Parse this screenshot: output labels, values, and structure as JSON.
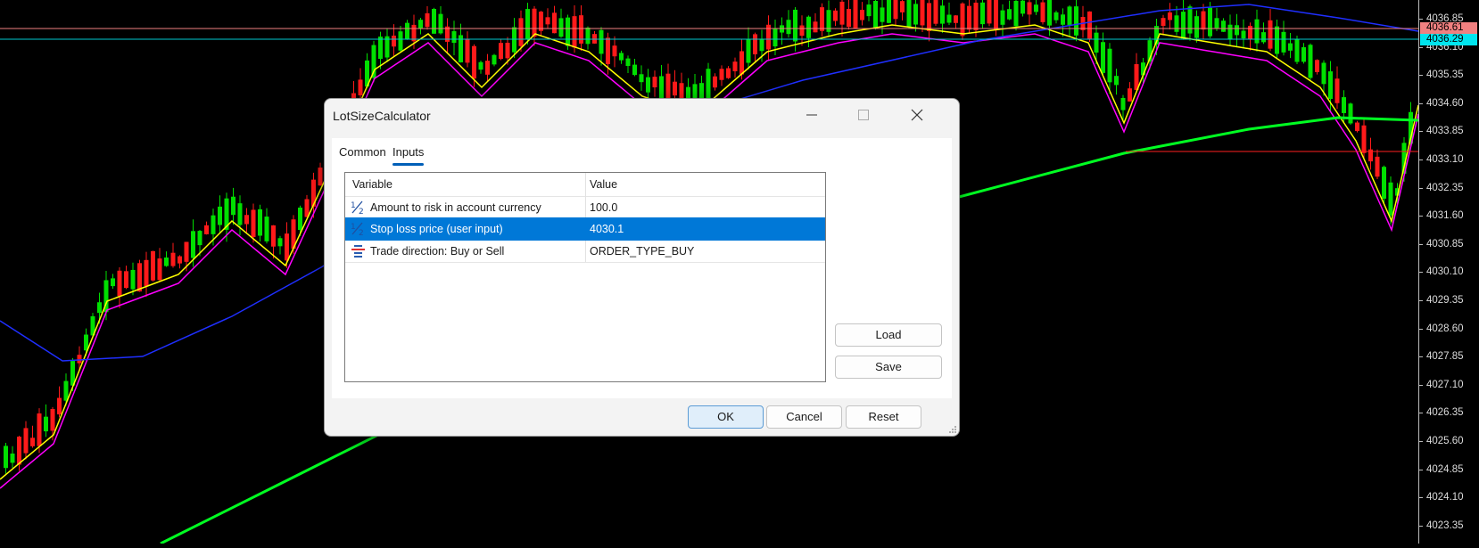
{
  "dialog": {
    "title": "LotSizeCalculator",
    "tabs": [
      {
        "label": "Common",
        "active": false
      },
      {
        "label": "Inputs",
        "active": true
      }
    ],
    "grid": {
      "headers": [
        "Variable",
        "Value"
      ],
      "rows": [
        {
          "icon": "fraction-icon",
          "name": "Amount to risk in account currency",
          "value": "100.0",
          "selected": false
        },
        {
          "icon": "fraction-icon",
          "name": "Stop loss price (user input)",
          "value": "4030.1",
          "selected": true
        },
        {
          "icon": "enum-list-icon",
          "name": "Trade direction: Buy or Sell",
          "value": "ORDER_TYPE_BUY",
          "selected": false
        }
      ]
    },
    "buttons": {
      "load": "Load",
      "save": "Save",
      "ok": "OK",
      "cancel": "Cancel",
      "reset": "Reset"
    }
  },
  "price_scale": {
    "ticks": [
      "4036.85",
      "4036.10",
      "4035.35",
      "4034.60",
      "4033.85",
      "4033.10",
      "4032.35",
      "4031.60",
      "4030.85",
      "4030.10",
      "4029.35",
      "4028.60",
      "4027.85",
      "4027.10",
      "4026.35",
      "4025.60",
      "4024.85",
      "4024.10",
      "4023.35"
    ],
    "badges": [
      {
        "label": "4036.61",
        "color": "#f08080"
      },
      {
        "label": "4036.29",
        "color": "#00e5ee"
      }
    ]
  },
  "colors": {
    "accent": "#0078d7",
    "bull": "#00e000",
    "bear": "#ff1a1a"
  }
}
